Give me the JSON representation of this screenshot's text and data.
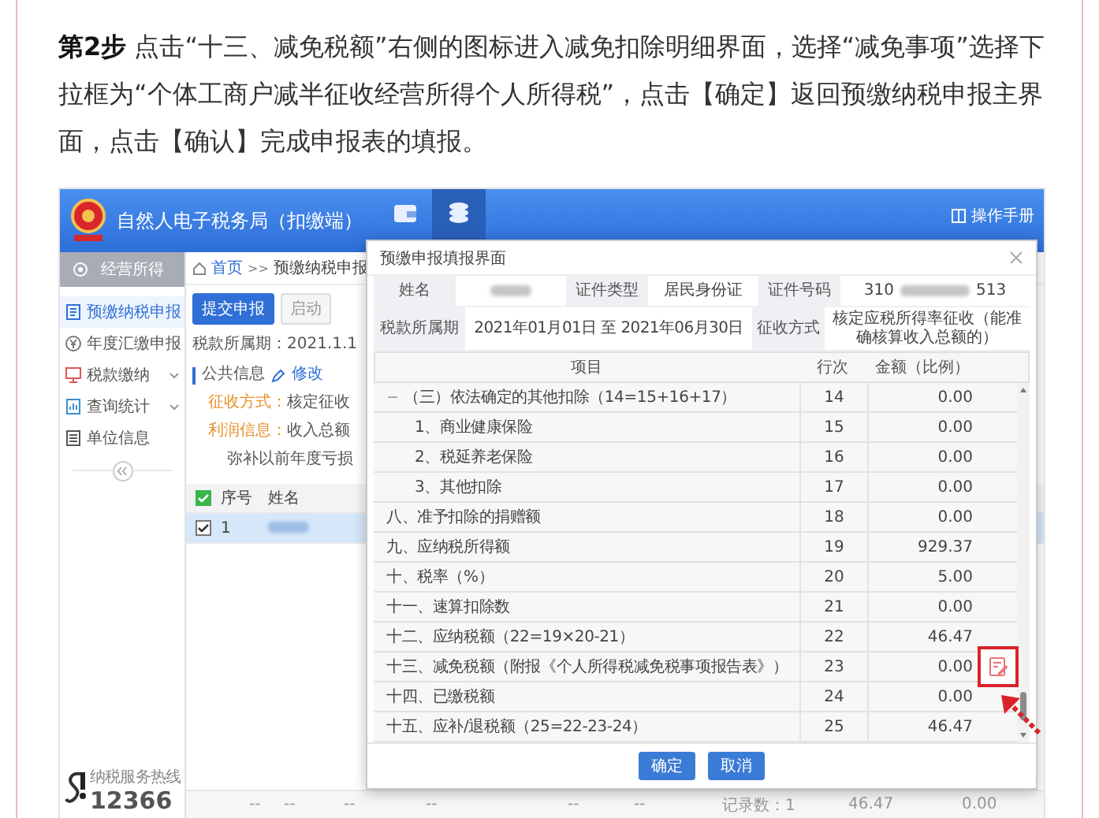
{
  "article": {
    "text": "**第2步** 点击“十三、减免税额”右侧的图标进入减免扣除明细界面，选择“减免事项”选择下拉框为“个体工商户减半征收经营所得个人所得税”，点击【确定】返回预缴纳税申报主界面，点击【确认】完成申报表的填报。"
  },
  "app": {
    "title": "自然人电子税务局（扣缴端）",
    "tabs": [
      {
        "kind": "wallet",
        "selected": false
      },
      {
        "kind": "coins",
        "selected": true
      }
    ],
    "help": "操作手册"
  },
  "sidebar": {
    "section": "经营所得",
    "items": [
      {
        "label": "预缴纳税申报",
        "kind": "form",
        "selected": true,
        "has_submenu": false
      },
      {
        "label": "年度汇缴申报",
        "kind": "yen",
        "selected": false,
        "has_submenu": false
      },
      {
        "label": "税款缴纳",
        "kind": "pay",
        "selected": false,
        "has_submenu": true
      },
      {
        "label": "查询统计",
        "kind": "chart",
        "selected": false,
        "has_submenu": true
      },
      {
        "label": "单位信息",
        "kind": "list",
        "selected": false,
        "has_submenu": false
      }
    ],
    "hotline": {
      "caption": "纳税服务热线",
      "number": "12366"
    }
  },
  "main": {
    "breadcrumb": {
      "home": "首页",
      "separator": ">>",
      "current": "预缴纳税申报"
    },
    "buttons": [
      {
        "label": "提交申报",
        "primary": true
      },
      {
        "label": "启动",
        "primary": false
      }
    ],
    "period": "税款所属期：2021.1.1",
    "public_info": {
      "title": "公共信息",
      "edit": "修改"
    },
    "fields": [
      {
        "label": "征收方式：",
        "value": "核定征收"
      },
      {
        "label": "利润信息：",
        "value": "收入总额"
      }
    ],
    "loss": "弥补以前年度亏损",
    "table": {
      "columns": [
        "序号",
        "姓名"
      ],
      "all_checked": true,
      "rows": [
        {
          "no": "1",
          "checked": true,
          "selected": true
        }
      ]
    },
    "footer": [
      "--",
      "--",
      "--",
      "--",
      "--",
      "--",
      "记录数：1",
      "46.47",
      "0.00"
    ]
  },
  "dialog": {
    "title": "预缴申报填报界面",
    "info": [
      [
        {
          "kind": "label",
          "text": "姓名"
        },
        {
          "kind": "redacted"
        },
        {
          "kind": "label",
          "text": "证件类型"
        },
        {
          "kind": "value",
          "text": "居民身份证"
        },
        {
          "kind": "label",
          "text": "证件号码"
        },
        {
          "kind": "id",
          "prefix": "310",
          "suffix": "513"
        }
      ],
      [
        {
          "kind": "label",
          "text": "税款所属期"
        },
        {
          "kind": "value",
          "text": "2021年01月01日 至 2021年06月30日"
        },
        {
          "kind": "label",
          "text": "征收方式"
        },
        {
          "kind": "value",
          "text": "核定应税所得率征收（能准确核算收入总额的）"
        }
      ]
    ],
    "table": {
      "columns": [
        "项目",
        "行次",
        "金额（比例）"
      ],
      "rows": [
        {
          "label": "（三）依法确定的其他扣除（14=15+16+17）",
          "line": "14",
          "amount": "0.00",
          "expanded": true,
          "children": [
            {
              "label": "1、商业健康保险",
              "line": "15",
              "amount": "0.00"
            },
            {
              "label": "2、税延养老保险",
              "line": "16",
              "amount": "0.00"
            },
            {
              "label": "3、其他扣除",
              "line": "17",
              "amount": "0.00"
            }
          ]
        },
        {
          "label": "八、准予扣除的捐赠额",
          "line": "18",
          "amount": "0.00"
        },
        {
          "label": "九、应纳税所得额",
          "line": "19",
          "amount": "929.37"
        },
        {
          "label": "十、税率（%）",
          "line": "20",
          "amount": "5.00"
        },
        {
          "label": "十一、速算扣除数",
          "line": "21",
          "amount": "0.00"
        },
        {
          "label": "十二、应纳税额（22=19×20-21）",
          "line": "22",
          "amount": "46.47"
        },
        {
          "label": "十三、减免税额（附报《个人所得税减免税事项报告表》）",
          "line": "23",
          "amount": "0.00",
          "has_edit": true,
          "callout": true
        },
        {
          "label": "十四、已缴税额",
          "line": "24",
          "amount": "0.00"
        },
        {
          "label": "十五、应补/退税额（25=22-23-24）",
          "line": "25",
          "amount": "46.47"
        }
      ]
    },
    "buttons": [
      "确定",
      "取消"
    ]
  }
}
